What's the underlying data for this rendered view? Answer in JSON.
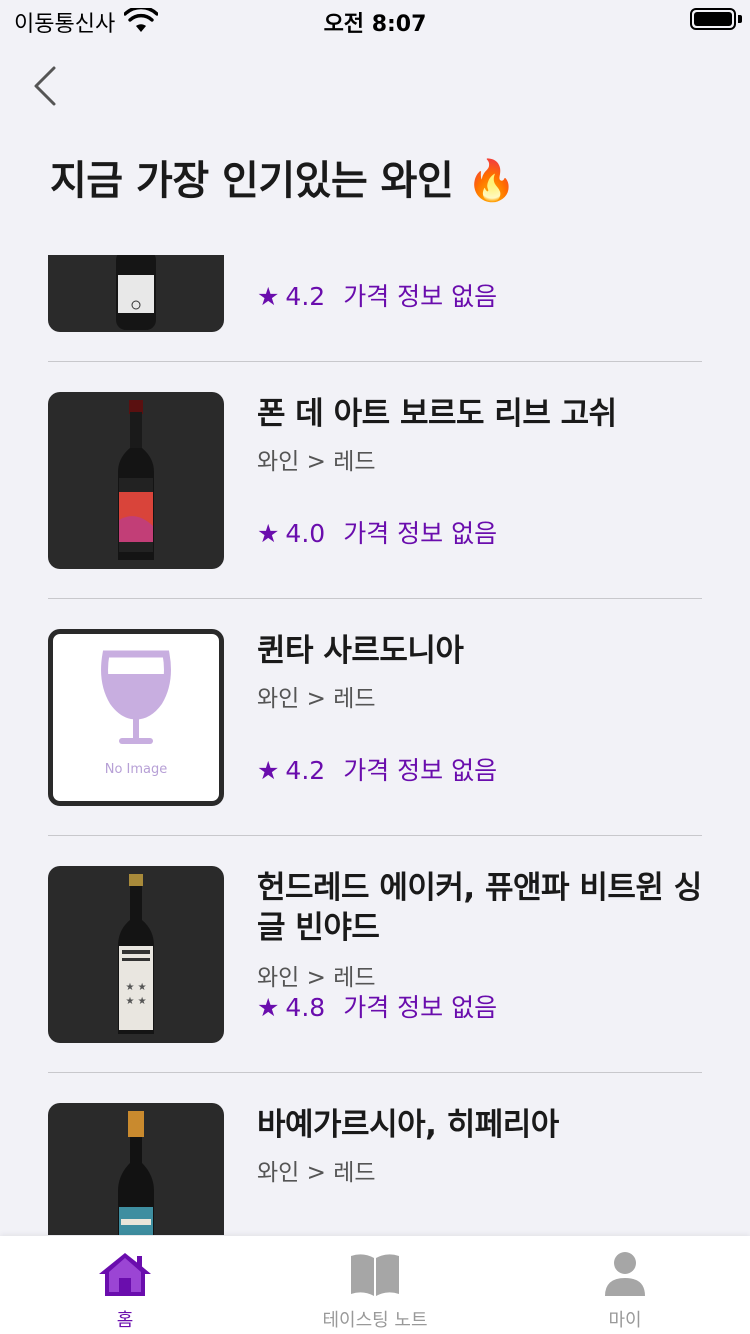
{
  "status_bar": {
    "carrier": "이동통신사",
    "time": "오전 8:07"
  },
  "header": {
    "title": "지금 가장 인기있는 와인 🔥"
  },
  "items": [
    {
      "name": "",
      "category": "",
      "rating": "4.2",
      "price": "가격 정보 없음"
    },
    {
      "name": "폰 데 아트 보르도 리브 고쉬",
      "category": "와인 > 레드",
      "rating": "4.0",
      "price": "가격 정보 없음"
    },
    {
      "name": "퀸타 사르도니아",
      "category": "와인 > 레드",
      "rating": "4.2",
      "price": "가격 정보 없음",
      "no_image_text": "No Image"
    },
    {
      "name": "헌드레드 에이커, 퓨앤파 비트윈 싱글 빈야드",
      "category": "와인 > 레드",
      "rating": "4.8",
      "price": "가격 정보 없음"
    },
    {
      "name": "바예가르시아, 히페리아",
      "category": "와인 > 레드",
      "rating": "",
      "price": ""
    }
  ],
  "star_glyph": "★",
  "tabs": [
    {
      "label": "홈",
      "icon": "home-icon",
      "active": true
    },
    {
      "label": "테이스팅 노트",
      "icon": "book-icon",
      "active": false
    },
    {
      "label": "마이",
      "icon": "person-icon",
      "active": false
    }
  ],
  "colors": {
    "accent": "#6a0dad",
    "inactive": "#9a9a9a",
    "background": "#f2f2f7"
  }
}
